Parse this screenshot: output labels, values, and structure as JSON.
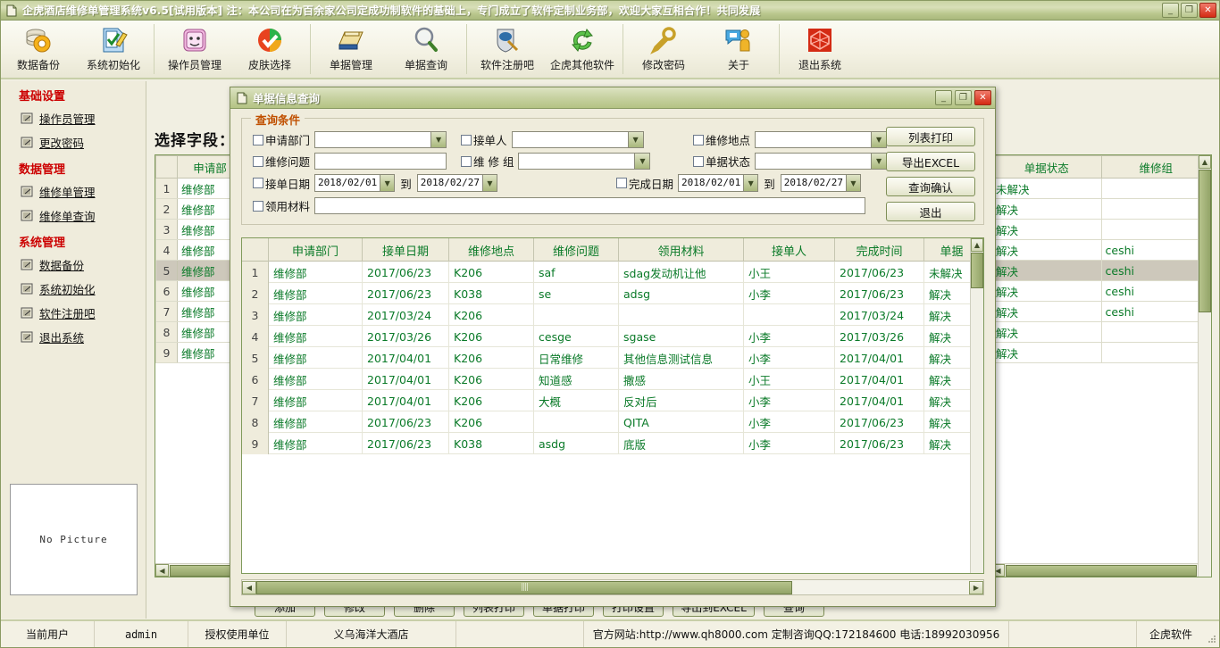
{
  "window": {
    "title": "企虎酒店维修单管理系统v6.5[试用版本] 注：本公司在为百余家公司定成功制软件的基础上，专门成立了软件定制业务部，欢迎大家互相合作！共同发展",
    "icon": "document-icon",
    "minimize": "_",
    "maximize": "❐",
    "close": "✕"
  },
  "toolbar": {
    "items": [
      {
        "label": "数据备份",
        "icon": "database-backup-icon"
      },
      {
        "label": "系统初始化",
        "icon": "system-init-icon"
      },
      {
        "label": "操作员管理",
        "icon": "operator-manage-icon"
      },
      {
        "label": "皮肤选择",
        "icon": "skin-select-icon"
      },
      {
        "label": "单据管理",
        "icon": "bill-manage-icon"
      },
      {
        "label": "单据查询",
        "icon": "bill-query-icon"
      },
      {
        "label": "软件注册吧",
        "icon": "software-register-icon"
      },
      {
        "label": "企虎其他软件",
        "icon": "other-software-icon"
      },
      {
        "label": "修改密码",
        "icon": "change-password-icon"
      },
      {
        "label": "关于",
        "icon": "about-icon"
      },
      {
        "label": "退出系统",
        "icon": "exit-icon"
      }
    ]
  },
  "sidebar": {
    "groups": [
      {
        "title": "基础设置",
        "items": [
          "操作员管理",
          "更改密码"
        ]
      },
      {
        "title": "数据管理",
        "items": [
          "维修单管理",
          "维修单查询"
        ]
      },
      {
        "title": "系统管理",
        "items": [
          "数据备份",
          "系统初始化",
          "软件注册吧",
          "退出系统"
        ]
      }
    ],
    "no_picture": "No Picture"
  },
  "workarea": {
    "field_title": "选择字段：",
    "left_grid": {
      "header": "申请部",
      "rows": [
        {
          "n": "1",
          "v": "维修部"
        },
        {
          "n": "2",
          "v": "维修部"
        },
        {
          "n": "3",
          "v": "维修部"
        },
        {
          "n": "4",
          "v": "维修部"
        },
        {
          "n": "5",
          "v": "维修部"
        },
        {
          "n": "6",
          "v": "维修部"
        },
        {
          "n": "7",
          "v": "维修部"
        },
        {
          "n": "8",
          "v": "维修部"
        },
        {
          "n": "9",
          "v": "维修部"
        }
      ],
      "selected_index": 4
    },
    "right_grid": {
      "headers": [
        "单据状态",
        "维修组"
      ],
      "rows": [
        [
          "未解决",
          ""
        ],
        [
          "解决",
          ""
        ],
        [
          "解决",
          ""
        ],
        [
          "解决",
          "ceshi"
        ],
        [
          "解决",
          "ceshi"
        ],
        [
          "解决",
          "ceshi"
        ],
        [
          "解决",
          "ceshi"
        ],
        [
          "解决",
          ""
        ],
        [
          "解决",
          ""
        ]
      ],
      "selected_index": 4
    },
    "buttons": [
      "添加",
      "修改",
      "删除",
      "列表打印",
      "单据打印",
      "打印设置",
      "导出到EXCEL",
      "查询"
    ]
  },
  "dialog": {
    "title": "单据信息查询",
    "icon": "document-icon",
    "minimize": "_",
    "maximize": "❐",
    "close": "✕",
    "group_legend": "查询条件",
    "fields": {
      "apply_dept": {
        "label": "申请部门",
        "value": "",
        "checked": false
      },
      "receiver": {
        "label": "接单人",
        "value": "",
        "checked": false
      },
      "repair_place": {
        "label": "维修地点",
        "value": "",
        "checked": false
      },
      "repair_problem": {
        "label": "维修问题",
        "value": "",
        "checked": false
      },
      "repair_group": {
        "label": "维 修 组",
        "value": "",
        "checked": false
      },
      "bill_status": {
        "label": "单据状态",
        "value": "",
        "checked": false
      },
      "receive_date": {
        "label": "接单日期",
        "from": "2018/02/01",
        "to": "2018/02/27",
        "to_label": "到",
        "checked": false
      },
      "finish_date": {
        "label": "完成日期",
        "from": "2018/02/01",
        "to": "2018/02/27",
        "to_label": "到",
        "checked": false
      },
      "material": {
        "label": "领用材料",
        "value": "",
        "checked": false
      }
    },
    "buttons": [
      "列表打印",
      "导出EXCEL",
      "查询确认",
      "退出"
    ],
    "grid": {
      "headers": [
        "",
        "申请部门",
        "接单日期",
        "维修地点",
        "维修问题",
        "领用材料",
        "接单人",
        "完成时间",
        "单据"
      ],
      "rows": [
        [
          "1",
          "维修部",
          "2017/06/23",
          "K206",
          "saf",
          "sdag发动机让他",
          "小王",
          "2017/06/23",
          "未解决"
        ],
        [
          "2",
          "维修部",
          "2017/06/23",
          "K038",
          "se",
          "adsg",
          "小李",
          "2017/06/23",
          "解决"
        ],
        [
          "3",
          "维修部",
          "2017/03/24",
          "K206",
          "",
          "",
          "",
          "2017/03/24",
          "解决"
        ],
        [
          "4",
          "维修部",
          "2017/03/26",
          "K206",
          "cesge",
          "sgase",
          "小李",
          "2017/03/26",
          "解决"
        ],
        [
          "5",
          "维修部",
          "2017/04/01",
          "K206",
          "日常维修",
          "其他信息测试信息",
          "小李",
          "2017/04/01",
          "解决"
        ],
        [
          "6",
          "维修部",
          "2017/04/01",
          "K206",
          "知道感",
          "撒感",
          "小王",
          "2017/04/01",
          "解决"
        ],
        [
          "7",
          "维修部",
          "2017/04/01",
          "K206",
          "大概",
          "反对后",
          "小李",
          "2017/04/01",
          "解决"
        ],
        [
          "8",
          "维修部",
          "2017/06/23",
          "K206",
          "",
          "QITA",
          "小李",
          "2017/06/23",
          "解决"
        ],
        [
          "9",
          "维修部",
          "2017/06/23",
          "K038",
          "asdg",
          "底版",
          "小李",
          "2017/06/23",
          "解决"
        ]
      ]
    }
  },
  "statusbar": {
    "current_user_label": "当前用户",
    "current_user": "admin",
    "license_label": "授权使用单位",
    "license_value": "义乌海洋大酒店",
    "contact": "官方网站:http://www.qh8000.com  定制咨询QQ:172184600  电话:18992030956",
    "vendor": "企虎软件"
  },
  "colors": {
    "accent_green": "#0a7a28",
    "header_green": "#b4c383",
    "legend_orange": "#c05000",
    "section_red": "#cc0000",
    "close_red": "#d42b14"
  }
}
